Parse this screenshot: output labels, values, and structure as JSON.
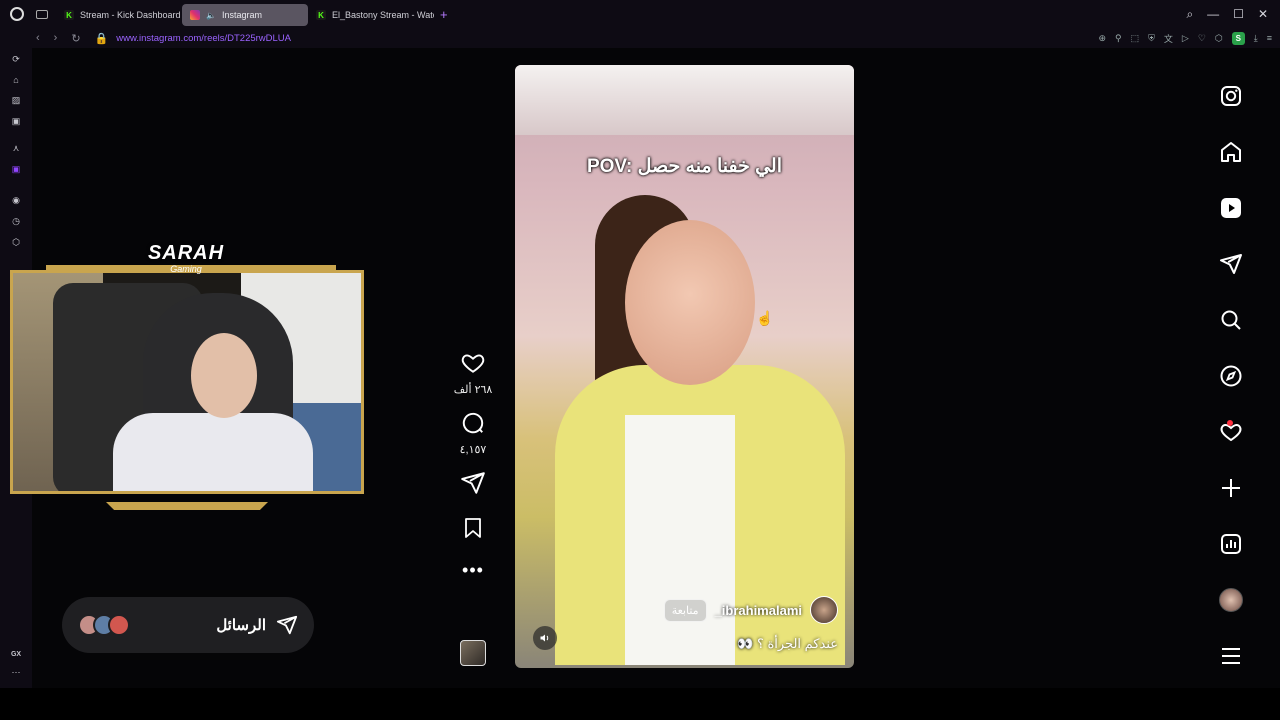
{
  "browser": {
    "tabs": [
      {
        "title": "Stream - Kick Dashboard",
        "icon": "kick-icon",
        "active": false
      },
      {
        "title": "Instagram",
        "icon": "instagram-icon",
        "active": true
      },
      {
        "title": "El_Bastony Stream - Watc",
        "icon": "kick-icon",
        "active": false
      }
    ],
    "new_tab": "+",
    "url": "www.instagram.com/reels/DT225rwDLUA",
    "extension_badge": "S"
  },
  "sidebar": {
    "gx_label": "GX"
  },
  "reel": {
    "caption": "POV: الي خفنا منه حصل",
    "username": "_ibrahimalami",
    "follow_label": "متابعة",
    "description": "عندكم الجرأة ؟ 👀"
  },
  "actions": {
    "likes": "٢٦٨ ألف",
    "comments": "٤,١٥٧"
  },
  "messages": {
    "label": "الرسائل"
  },
  "overlay": {
    "brand": "SARAH",
    "subtitle": "Gaming"
  },
  "colors": {
    "accent": "#9b63ff",
    "kick_green": "#53fc18",
    "notification": "#ff3040",
    "gold": "#c9a54e"
  }
}
